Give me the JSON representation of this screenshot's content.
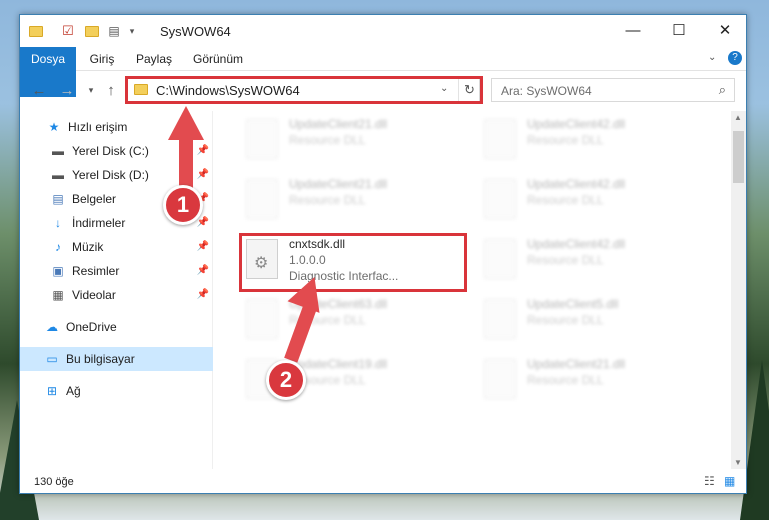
{
  "window": {
    "title": "SysWOW64"
  },
  "ribbon": {
    "tabs": [
      "Dosya",
      "Giriş",
      "Paylaş",
      "Görünüm"
    ]
  },
  "address": {
    "path": "C:\\Windows\\SysWOW64"
  },
  "search": {
    "placeholder": "Ara: SysWOW64"
  },
  "sidebar": {
    "items": [
      {
        "label": "Hızlı erişim",
        "icon": "star-icon"
      },
      {
        "label": "Yerel Disk (C:)",
        "icon": "drive-icon"
      },
      {
        "label": "Yerel Disk (D:)",
        "icon": "drive-icon"
      },
      {
        "label": "Belgeler",
        "icon": "documents-icon"
      },
      {
        "label": "İndirmeler",
        "icon": "downloads-icon"
      },
      {
        "label": "Müzik",
        "icon": "music-icon"
      },
      {
        "label": "Resimler",
        "icon": "pictures-icon"
      },
      {
        "label": "Videolar",
        "icon": "videos-icon"
      },
      {
        "label": "OneDrive",
        "icon": "cloud-icon"
      },
      {
        "label": "Bu bilgisayar",
        "icon": "computer-icon"
      },
      {
        "label": "Ağ",
        "icon": "network-icon"
      }
    ]
  },
  "files": {
    "left": [
      {
        "name": "UpdateClient21.dll",
        "sub": "Resource DLL"
      },
      {
        "name": "UpdateClient21.dll",
        "sub": "Resource DLL"
      },
      {
        "name": "cnxtsdk.dll",
        "version": "1.0.0.0",
        "description": "Diagnostic Interfac..."
      },
      {
        "name": "UpdateClient63.dll",
        "sub": "Resource DLL"
      },
      {
        "name": "UpdateClient19.dll",
        "sub": "Resource DLL"
      }
    ],
    "right": [
      {
        "name": "UpdateClient42.dll",
        "sub": "Resource DLL"
      },
      {
        "name": "UpdateClient42.dll",
        "sub": "Resource DLL"
      },
      {
        "name": "UpdateClient42.dll",
        "sub": "Resource DLL"
      },
      {
        "name": "UpdateClient5.dll",
        "sub": "Resource DLL"
      },
      {
        "name": "UpdateClient21.dll",
        "sub": "Resource DLL"
      }
    ]
  },
  "status": {
    "count": "130 öğe"
  },
  "annotations": {
    "step1": "1",
    "step2": "2"
  },
  "colors": {
    "accent": "#1979ca",
    "highlight": "#d9343a",
    "selected": "#cce8ff"
  }
}
